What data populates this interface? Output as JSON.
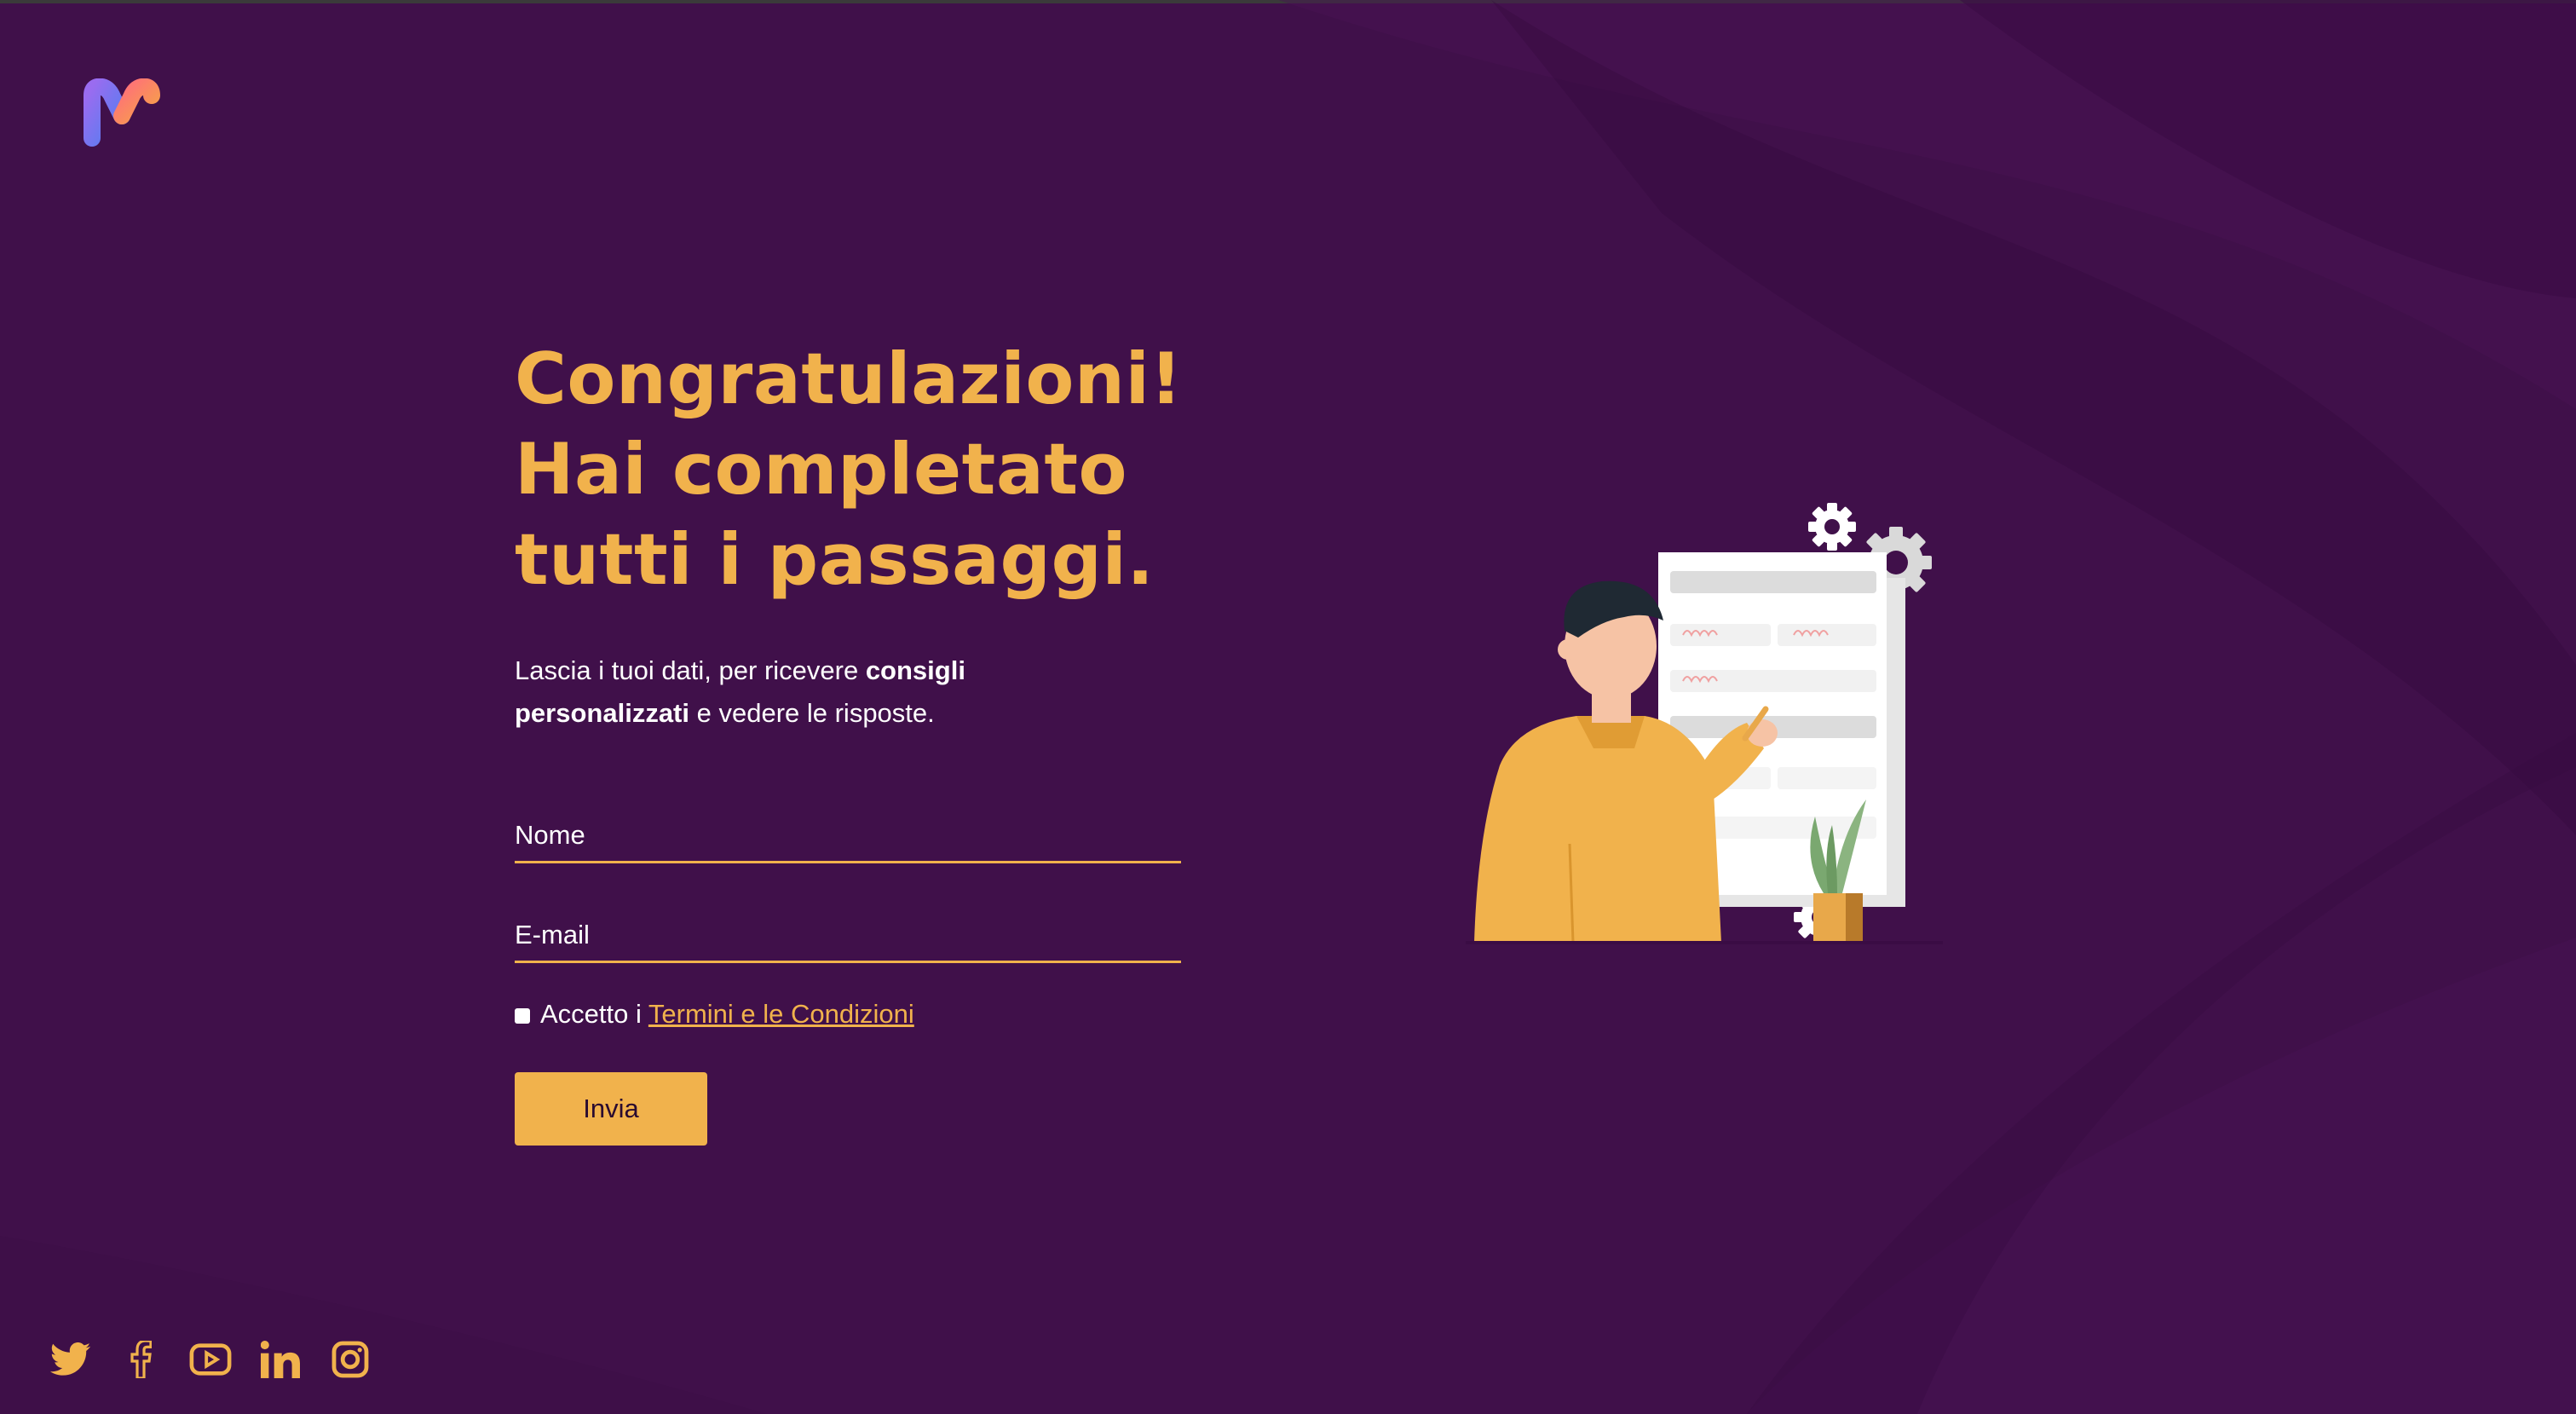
{
  "brand": {
    "logo_icon": "m-logo-icon",
    "colors": {
      "background": "#40104a",
      "accent": "#f1b24c",
      "text": "#ffffff"
    }
  },
  "main": {
    "headline": {
      "line1": "Congratulazioni!",
      "line2": "Hai completato",
      "line3": "tutti i passaggi."
    },
    "description": {
      "part1": "Lascia i tuoi dati, per ricevere ",
      "bold1": "consigli",
      "bold2": "personalizzati",
      "part2": " e vedere le risposte."
    }
  },
  "form": {
    "name_placeholder": "Nome",
    "email_placeholder": "E-mail",
    "terms_prefix": "Accetto i",
    "terms_link": "Termini e le Condizioni",
    "submit_label": "Invia"
  },
  "illustration": {
    "icon": "man-filling-form-illustration"
  },
  "socials": [
    {
      "icon": "twitter-icon"
    },
    {
      "icon": "facebook-icon"
    },
    {
      "icon": "youtube-icon"
    },
    {
      "icon": "linkedin-icon"
    },
    {
      "icon": "instagram-icon"
    }
  ]
}
